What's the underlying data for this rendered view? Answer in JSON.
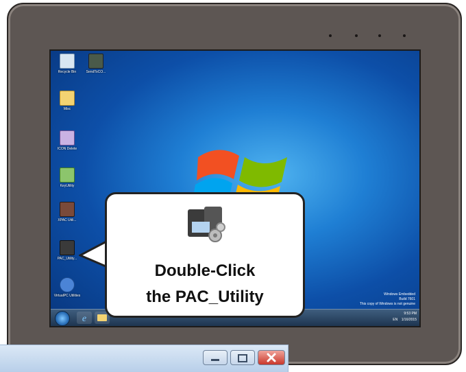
{
  "desktop": {
    "icons": [
      {
        "label": "Recycle Bin",
        "icon": "recycle-bin-icon"
      },
      {
        "label": "SendToCO...",
        "icon": "send-to-icon"
      },
      {
        "label": "Misc",
        "icon": "folder-icon"
      },
      {
        "label": "ICON Delete",
        "icon": "app-icon"
      },
      {
        "label": "KeyUtility",
        "icon": "key-utility-icon"
      },
      {
        "label": "XPAC Utili...",
        "icon": "device-icon"
      },
      {
        "label": "PAC_Utility...",
        "icon": "pac-utility-icon"
      },
      {
        "label": "VirtualPC Utilities",
        "icon": "virtual-icon"
      }
    ],
    "watermark": [
      "Windows Embedded",
      "Build 7601",
      "This copy of Windows is not genuine"
    ],
    "clock": {
      "time": "9:53 PM",
      "date": "1/16/2015"
    },
    "tray_lang": "EN"
  },
  "callout": {
    "line1": "Double-Click",
    "line2": "the PAC_Utility"
  },
  "colors": {
    "bezel": "#5d5653",
    "desktop": "#1f7fd4",
    "close_button": "#d9534f"
  }
}
